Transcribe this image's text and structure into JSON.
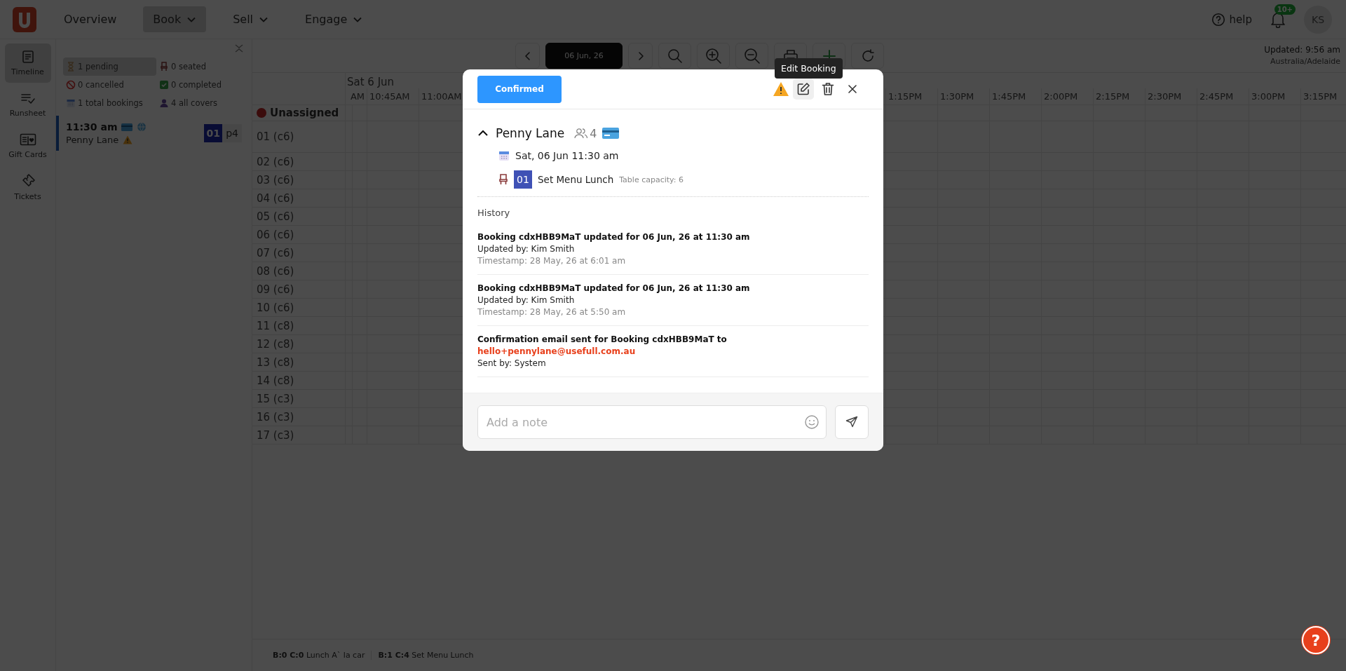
{
  "topbar": {
    "nav": [
      {
        "label": "Overview",
        "selected": false,
        "dropdown": false
      },
      {
        "label": "Book",
        "selected": true,
        "dropdown": true
      },
      {
        "label": "Sell",
        "selected": false,
        "dropdown": true
      },
      {
        "label": "Engage",
        "selected": false,
        "dropdown": true
      }
    ],
    "help": "help",
    "notification_badge": "10+",
    "avatar_initials": "KS"
  },
  "rail": {
    "items": [
      {
        "label": "Timeline",
        "selected": true
      },
      {
        "label": "Runsheet",
        "selected": false
      },
      {
        "label": "Gift Cards",
        "selected": false
      },
      {
        "label": "Tickets",
        "selected": false
      }
    ]
  },
  "panel": {
    "stats": [
      {
        "label": "1 pending",
        "selected": true
      },
      {
        "label": "0 seated",
        "selected": false
      },
      {
        "label": "0 cancelled",
        "selected": false
      },
      {
        "label": "0 completed",
        "selected": false
      },
      {
        "label": "1 total bookings",
        "selected": false
      },
      {
        "label": "4 all covers",
        "selected": false
      }
    ],
    "booking": {
      "time": "11:30 am",
      "name": "Penny Lane",
      "table": "01",
      "party": "p4"
    }
  },
  "toolbar": {
    "date": "06 Jun, 26",
    "updated": "Updated: 9:56 am",
    "timezone": "Australia/Adelaide"
  },
  "timeline": {
    "date_header": "Sat 6 Jun",
    "times_before": [
      "AM",
      "10:45AM",
      "11:00AM"
    ],
    "times_after": [
      "1:15PM",
      "1:30PM",
      "1:45PM",
      "2:00PM",
      "2:15PM",
      "2:30PM",
      "2:45PM",
      "3:00PM",
      "3:15PM"
    ],
    "unassigned": "Unassigned",
    "tables": [
      "01 (c6)",
      "02 (c6)",
      "03 (c6)",
      "04 (c6)",
      "05 (c6)",
      "06 (c6)",
      "07 (c6)",
      "08 (c6)",
      "09 (c6)",
      "10 (c6)",
      "11 (c8)",
      "12 (c8)",
      "13 (c8)",
      "14 (c8)",
      "15 (c3)",
      "16 (c3)",
      "17 (c3)"
    ]
  },
  "legend": [
    "**B:0 C:0** Lunch A` la car",
    "**B:1 C:4** Set Menu Lunch"
  ],
  "modal": {
    "status": "Confirmed",
    "tooltip": "Edit Booking",
    "guest": {
      "name": "Penny Lane",
      "covers": "4",
      "expanded": true
    },
    "date": "Sat, 06 Jun 11:30 am",
    "table": "01",
    "menu": "Set Menu Lunch",
    "capacity": "Table capacity: 6",
    "history_label": "History",
    "history": [
      {
        "title": "Booking cdxHBB9MaT updated for 06 Jun, 26 at 11:30 am",
        "by": "Updated by: Kim Smith",
        "timestamp": "Timestamp: 28 May, 26 at 6:01 am"
      },
      {
        "title": "Booking cdxHBB9MaT updated for 06 Jun, 26 at 11:30 am",
        "by": "Updated by: Kim Smith",
        "timestamp": "Timestamp: 28 May, 26 at 5:50 am"
      },
      {
        "title": "Confirmation email sent for Booking cdxHBB9MaT to",
        "email": "hello+pennylane@usefull.com.au",
        "by": "Sent by: System"
      }
    ],
    "note": {
      "placeholder": "Add a note"
    }
  },
  "help_fab": "?"
}
